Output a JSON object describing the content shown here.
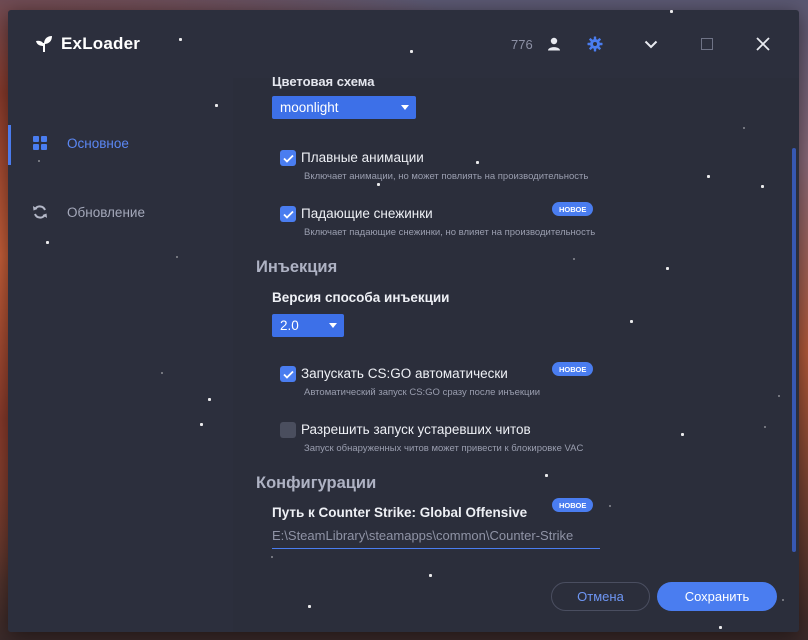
{
  "app": {
    "title": "ExLoader",
    "online_count": "776"
  },
  "titlebar": {
    "user_icon": "user-icon",
    "settings_icon": "gear-icon",
    "collapse_icon": "chevron-down-icon",
    "maximize_icon": "square-icon",
    "close_icon": "close-icon"
  },
  "sidebar": {
    "items": [
      {
        "label": "Основное",
        "icon": "grid-icon",
        "active": true
      },
      {
        "label": "Обновление",
        "icon": "refresh-icon",
        "active": false
      }
    ]
  },
  "settings": {
    "color_scheme_label": "Цветовая схема",
    "color_scheme_value": "moonlight",
    "smooth_animations": {
      "title": "Плавные анимации",
      "desc": "Включает анимации, но может повлиять на производительность",
      "checked": true
    },
    "snowflakes": {
      "title": "Падающие снежинки",
      "desc": "Включает падающие снежинки, но влияет на производительность",
      "checked": true,
      "badge": "НОВОЕ"
    },
    "injection_section": "Инъекция",
    "injection_version_label": "Версия способа инъекции",
    "injection_version_value": "2.0",
    "auto_launch": {
      "title": "Запускать CS:GO автоматически",
      "desc": "Автоматический запуск CS:GO сразу после инъекции",
      "checked": true,
      "badge": "НОВОЕ"
    },
    "outdated_cheats": {
      "title": "Разрешить запуск устаревших читов",
      "desc": "Запуск обнаруженных читов может привести к блокировке VAC",
      "checked": false
    },
    "config_section": "Конфигурации",
    "csgo_path_label": "Путь к Counter Strike: Global Offensive",
    "csgo_path_badge": "НОВОЕ",
    "csgo_path_value": "E:\\SteamLibrary\\steamapps\\common\\Counter-Strike"
  },
  "actions": {
    "cancel": "Отмена",
    "save": "Сохранить"
  },
  "colors": {
    "accent": "#4a7df0",
    "background": "#2c2f3d"
  }
}
